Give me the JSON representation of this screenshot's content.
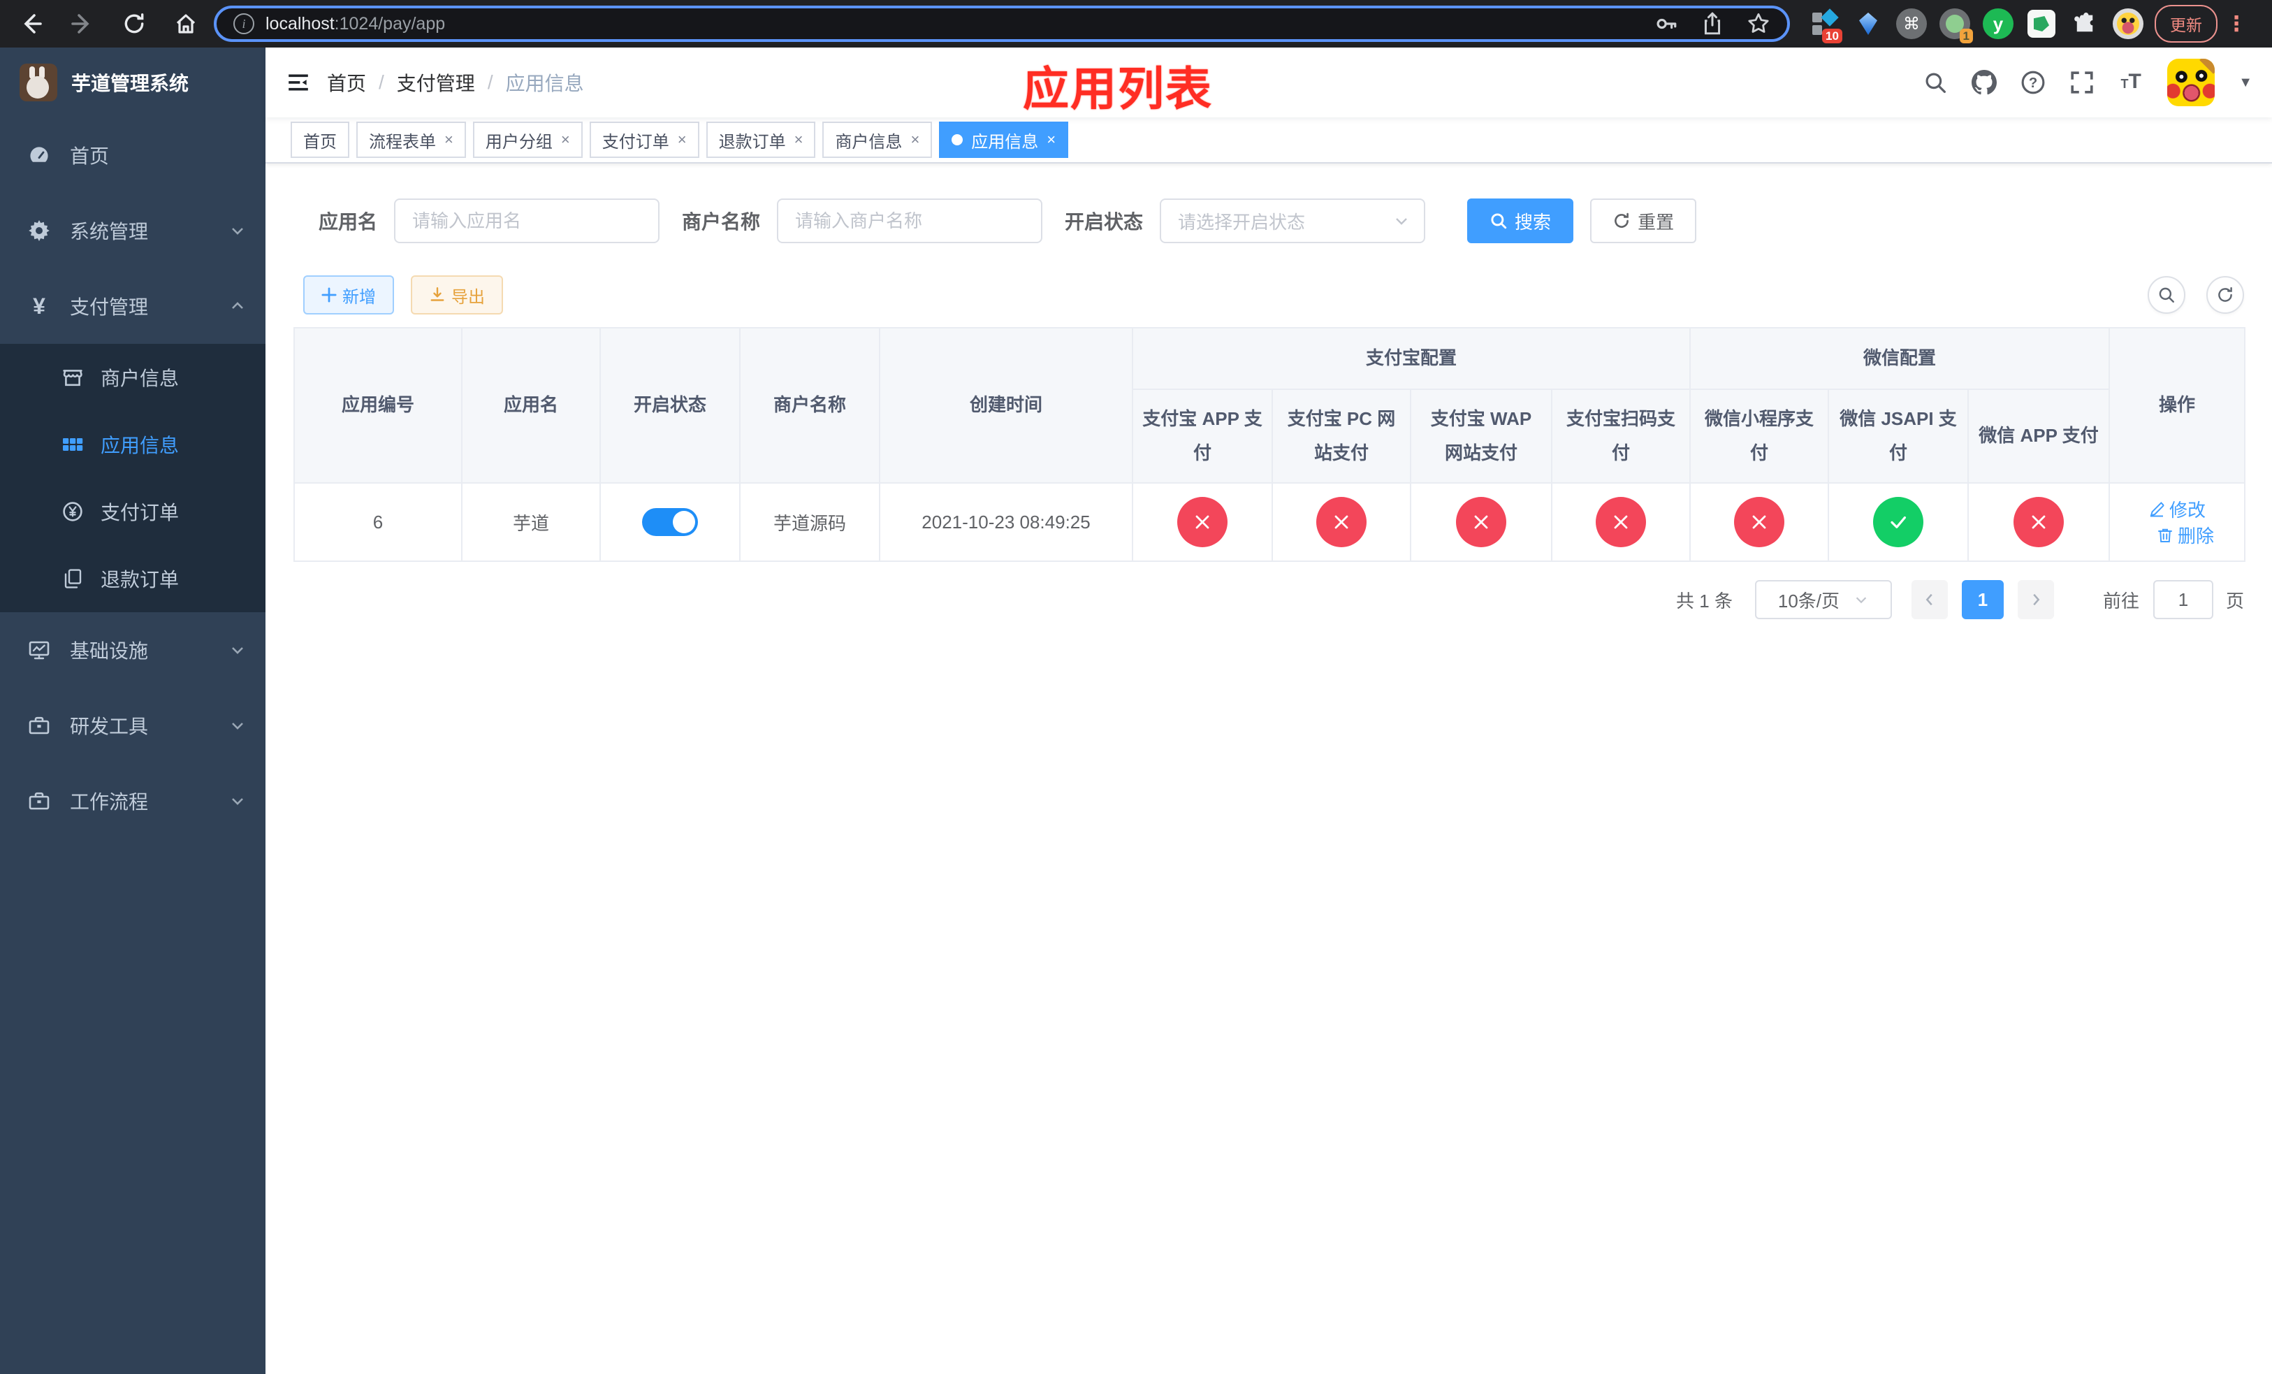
{
  "colors": {
    "primary": "#409eff",
    "sidebar_bg": "#304156",
    "submenu_bg": "#1f2d3d",
    "menu_text": "#bfcbd9",
    "danger_circle": "#f3465a",
    "success_circle": "#13ce66",
    "switch_on": "#1e8ef7",
    "annotation_red": "#ff2d23",
    "warning_text": "#e6a23c",
    "tab_active_bg": "#409eff",
    "browser_bar_bg": "#202124",
    "url_focus_ring": "#5b93f8",
    "update_chip": "#f28b82"
  },
  "browser": {
    "url_host": "localhost",
    "url_path": ":1024/pay/app",
    "update_button": "更新",
    "ext_badge_a": "10",
    "ext_badge_b": "1",
    "ext_letter": "y"
  },
  "sidebar": {
    "title": "芋道管理系统",
    "home": "首页",
    "system": "系统管理",
    "payment": "支付管理",
    "sub_merchant": "商户信息",
    "sub_app": "应用信息",
    "sub_pay_order": "支付订单",
    "sub_refund_order": "退款订单",
    "infra": "基础设施",
    "devtools": "研发工具",
    "workflow": "工作流程",
    "payment_icon_glyph": "¥"
  },
  "navbar": {
    "breadcrumb_home": "首页",
    "breadcrumb_section": "支付管理",
    "breadcrumb_current": "应用信息",
    "annotation": "应用列表"
  },
  "tabs": [
    {
      "label": "首页"
    },
    {
      "label": "流程表单"
    },
    {
      "label": "用户分组"
    },
    {
      "label": "支付订单"
    },
    {
      "label": "退款订单"
    },
    {
      "label": "商户信息"
    },
    {
      "label": "应用信息"
    }
  ],
  "filters": {
    "app_name_label": "应用名",
    "app_name_placeholder": "请输入应用名",
    "merchant_label": "商户名称",
    "merchant_placeholder": "请输入商户名称",
    "status_label": "开启状态",
    "status_placeholder": "请选择开启状态",
    "search_button": "搜索",
    "reset_button": "重置"
  },
  "toolbar": {
    "add_button": "新增",
    "export_button": "导出"
  },
  "table": {
    "headers": {
      "app_id": "应用编号",
      "app_name": "应用名",
      "status": "开启状态",
      "merchant": "商户名称",
      "created": "创建时间",
      "alipay_group": "支付宝配置",
      "wechat_group": "微信配置",
      "alipay_app": "支付宝 APP 支付",
      "alipay_pc": "支付宝 PC 网站支付",
      "alipay_wap": "支付宝 WAP 网站支付",
      "alipay_qr": "支付宝扫码支付",
      "wx_lite": "微信小程序支付",
      "wx_jsapi": "微信 JSAPI 支付",
      "wx_app": "微信 APP 支付",
      "actions": "操作"
    },
    "row": {
      "app_id": "6",
      "app_name": "芋道",
      "enabled": true,
      "merchant": "芋道源码",
      "created": "2021-10-23 08:49:25",
      "channel_status": {
        "alipay_app": false,
        "alipay_pc": false,
        "alipay_wap": false,
        "alipay_qr": false,
        "wx_lite": false,
        "wx_jsapi": true,
        "wx_app": false
      },
      "edit_action": "修改",
      "delete_action": "删除"
    }
  },
  "pagination": {
    "total_text": "共 1 条",
    "page_size": "10条/页",
    "current_page": "1",
    "goto_label": "前往",
    "goto_value": "1",
    "page_suffix": "页"
  }
}
